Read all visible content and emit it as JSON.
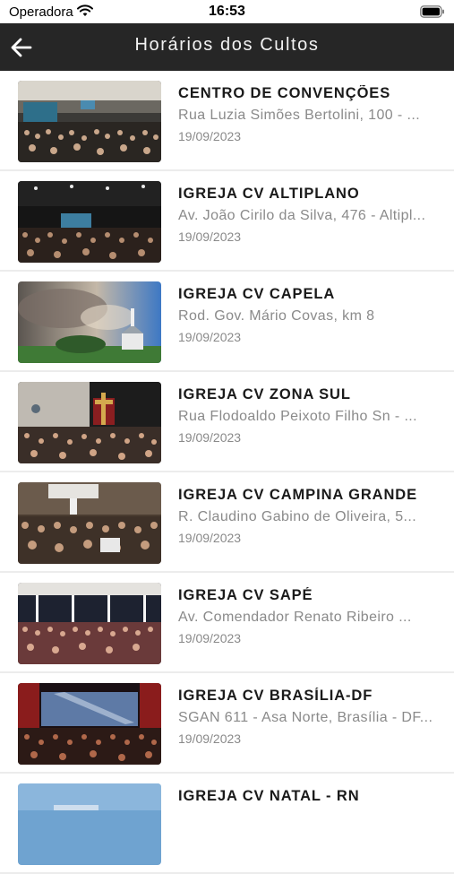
{
  "status_bar": {
    "carrier": "Operadora",
    "time": "16:53"
  },
  "header": {
    "title": "Horários dos Cultos",
    "back_icon": "arrow-left-icon"
  },
  "churches": [
    {
      "name": "CENTRO DE CONVENÇÕES",
      "address": "Rua Luzia Simões Bertolini, 100 - ...",
      "date": "19/09/2023"
    },
    {
      "name": "IGREJA CV ALTIPLANO",
      "address": "Av. João Cirilo da Silva, 476 - Altipl...",
      "date": "19/09/2023"
    },
    {
      "name": "IGREJA CV CAPELA",
      "address": "Rod. Gov. Mário Covas, km 8",
      "date": "19/09/2023"
    },
    {
      "name": "IGREJA CV ZONA SUL",
      "address": "Rua Flodoaldo Peixoto Filho Sn - ...",
      "date": "19/09/2023"
    },
    {
      "name": "IGREJA CV CAMPINA GRANDE",
      "address": "R. Claudino Gabino de Oliveira, 5...",
      "date": "19/09/2023"
    },
    {
      "name": "IGREJA CV SAPÉ",
      "address": "Av. Comendador Renato Ribeiro ...",
      "date": "19/09/2023"
    },
    {
      "name": "IGREJA CV BRASÍLIA-DF",
      "address": "SGAN 611 - Asa Norte, Brasília - DF...",
      "date": "19/09/2023"
    },
    {
      "name": "IGREJA CV NATAL - RN",
      "address": "",
      "date": ""
    }
  ],
  "colors": {
    "header_bg": "#262626",
    "header_text": "#f2f2f2",
    "secondary_text": "#8a8a8a",
    "divider": "#ececec"
  }
}
